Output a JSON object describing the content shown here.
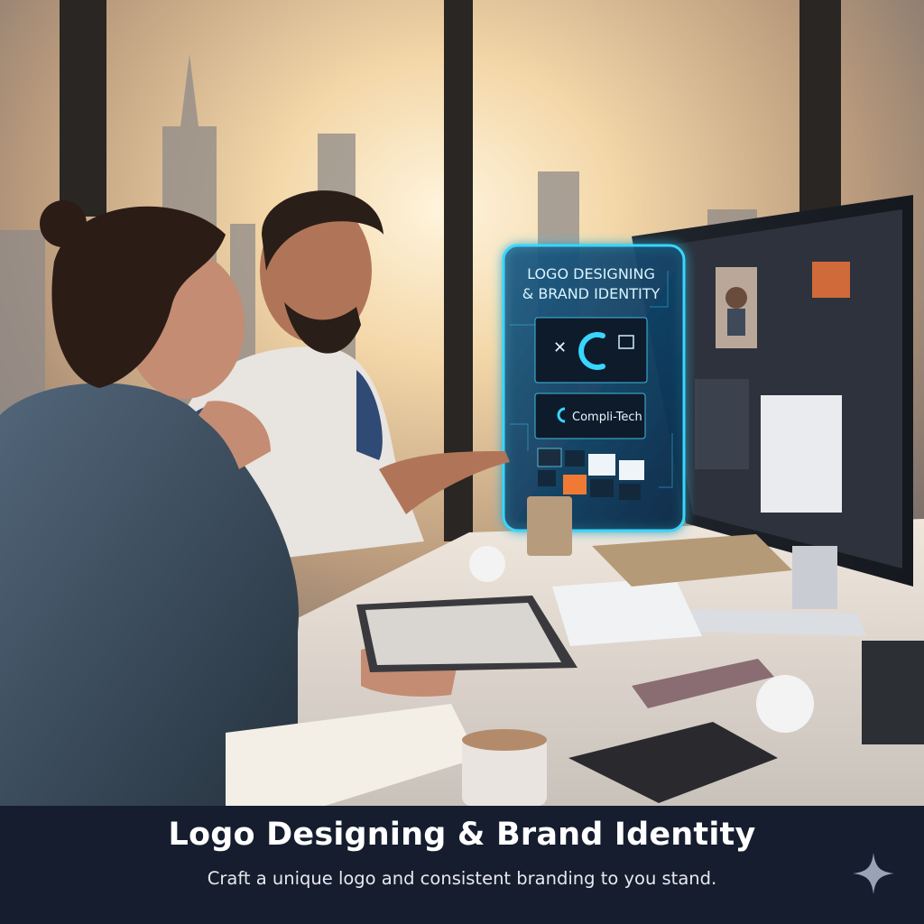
{
  "hologram": {
    "heading_line1": "LOGO DESIGNING",
    "heading_line2": "& BRAND IDENTITY",
    "brand_name": "Compli-Tech"
  },
  "caption": {
    "title": "Logo Designing & Brand Identity",
    "subtitle": "Craft a unique logo and consistent branding to you stand."
  },
  "colors": {
    "caption_band": "#151d2e",
    "hologram_glow": "#38d6ff",
    "sky": "#e9c79a"
  },
  "icons": {
    "corner_mark": "four-point-sparkle-icon"
  }
}
